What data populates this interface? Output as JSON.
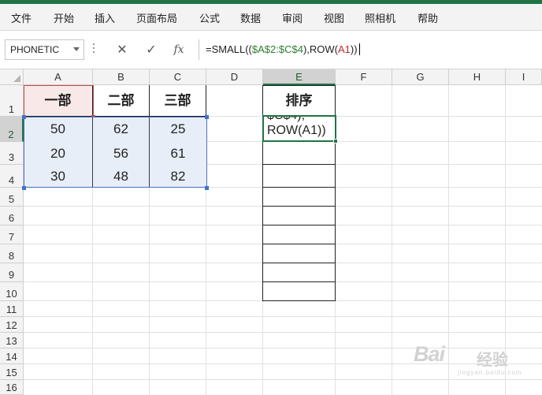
{
  "menu": [
    "文件",
    "开始",
    "插入",
    "页面布局",
    "公式",
    "数据",
    "审阅",
    "视图",
    "照相机",
    "帮助"
  ],
  "formula_bar": {
    "name_box": "PHONETIC",
    "cancel_glyph": "✕",
    "enter_glyph": "✓",
    "fx_label": "fx",
    "formula_prefix": "=SMALL((",
    "formula_ref": "$A$2:$C$4",
    "formula_mid": "),ROW(",
    "formula_ref2": "A1",
    "formula_suffix": "))"
  },
  "columns": [
    "A",
    "B",
    "C",
    "D",
    "E",
    "F",
    "G",
    "H",
    "I"
  ],
  "rows": [
    "1",
    "2",
    "3",
    "4",
    "5",
    "6",
    "7",
    "8",
    "9",
    "10",
    "11",
    "12",
    "13",
    "14",
    "15",
    "16"
  ],
  "table": {
    "headers": [
      "一部",
      "二部",
      "三部"
    ],
    "data": [
      [
        "50",
        "62",
        "25"
      ],
      [
        "20",
        "56",
        "61"
      ],
      [
        "30",
        "48",
        "82"
      ]
    ]
  },
  "sort_column": {
    "header": "排序",
    "edit_line1": "$C$4),",
    "edit_line2": "ROW(A1))"
  },
  "watermark": {
    "text": "Bai",
    "cn": "经验",
    "sub": "jingyan.baidu.com"
  },
  "colors": {
    "excel_green": "#217346",
    "range_blue": "#4472c4",
    "range_red": "#c0504d",
    "table_fill": "#e8eef8",
    "header_fill": "#f9e8e8"
  }
}
